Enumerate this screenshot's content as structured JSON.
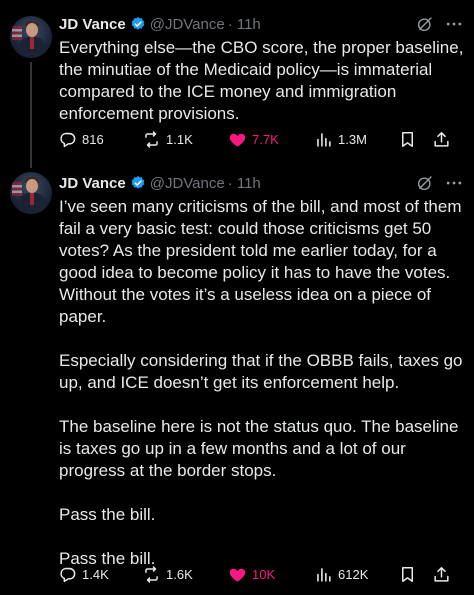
{
  "tweets": [
    {
      "author_name": "JD Vance",
      "handle": "@JDVance",
      "time": "· 11h",
      "paragraphs": [
        "Everything else—the CBO score, the proper baseline, the minutiae of the Medicaid policy—is immaterial compared to the ICE money and immigration enforcement provisions."
      ],
      "replies": "816",
      "reposts": "1.1K",
      "likes": "7.7K",
      "views": "1.3M"
    },
    {
      "author_name": "JD Vance",
      "handle": "@JDVance",
      "time": "· 11h",
      "paragraphs": [
        "I’ve seen many criticisms of the bill, and most of them fail a very basic test: could those criticisms get 50 votes? As the president told me earlier today, for a good idea to become policy it has to have the votes. Without the votes it’s a useless idea on a piece of paper.",
        "Especially considering that if the OBBB fails, taxes go up, and ICE doesn’t get its enforcement help.",
        "The baseline here is not the status quo. The baseline is taxes go up in a few months and a lot of our progress at the border stops.",
        "Pass the bill.",
        "Pass the bill."
      ],
      "replies": "1.4K",
      "reposts": "1.6K",
      "likes": "10K",
      "views": "612K"
    }
  ],
  "icons": {
    "verified": "verified-badge-icon",
    "grok": "grok-icon",
    "more": "more-icon",
    "reply": "reply-icon",
    "repost": "repost-icon",
    "like": "heart-icon",
    "views": "views-icon",
    "bookmark": "bookmark-icon",
    "share": "share-icon"
  },
  "colors": {
    "background": "#000000",
    "text": "#e7e9ea",
    "secondary": "#71767b",
    "like_active": "#f91880",
    "verified": "#1d9bf0"
  }
}
